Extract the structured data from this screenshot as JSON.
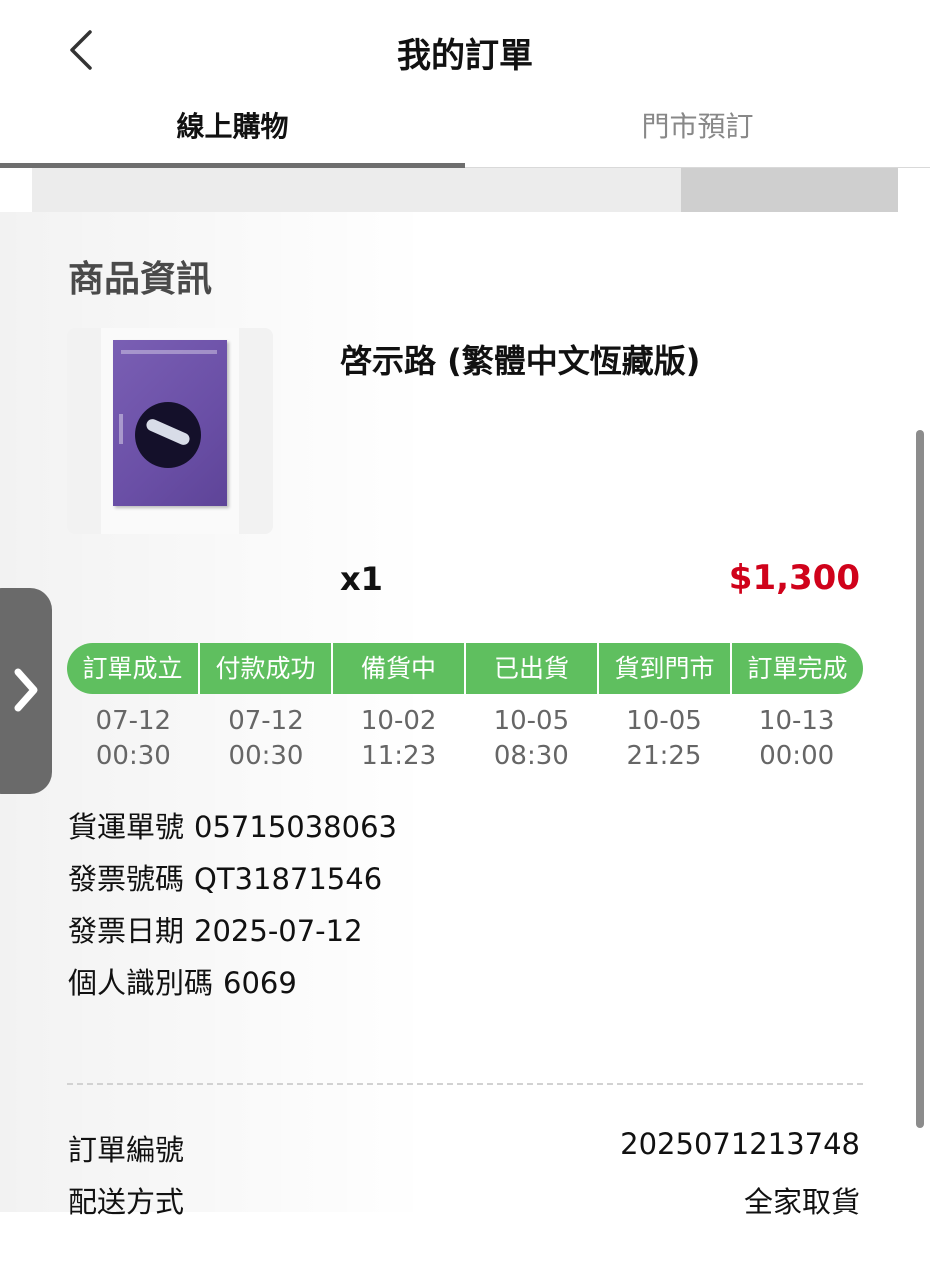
{
  "header": {
    "title": "我的訂單",
    "back_icon": "chevron-left-icon"
  },
  "tabs": [
    {
      "label": "線上購物",
      "active": true
    },
    {
      "label": "門市預訂",
      "active": false
    }
  ],
  "product_section": {
    "title": "商品資訊",
    "name": "啓示路 (繁體中文恆藏版)",
    "quantity": "x1",
    "price": "$1,300",
    "price_color": "#d0021b"
  },
  "progress": {
    "accent_color": "#5fbf5f",
    "steps": [
      {
        "label": "訂單成立",
        "date": "07-12",
        "time": "00:30"
      },
      {
        "label": "付款成功",
        "date": "07-12",
        "time": "00:30"
      },
      {
        "label": "備貨中",
        "date": "10-02",
        "time": "11:23"
      },
      {
        "label": "已出貨",
        "date": "10-05",
        "time": "08:30"
      },
      {
        "label": "貨到門市",
        "date": "10-05",
        "time": "21:25"
      },
      {
        "label": "訂單完成",
        "date": "10-13",
        "time": "00:00"
      }
    ]
  },
  "shipment_info": [
    {
      "label": "貨運單號",
      "value": "05715038063"
    },
    {
      "label": "發票號碼",
      "value": "QT31871546"
    },
    {
      "label": "發票日期",
      "value": "2025-07-12"
    },
    {
      "label": "個人識別碼",
      "value": "6069"
    }
  ],
  "summary": [
    {
      "label": "訂單編號",
      "value": "2025071213748"
    },
    {
      "label": "配送方式",
      "value": "全家取貨"
    }
  ],
  "side_tab": {
    "icon": "chevron-right-icon"
  }
}
